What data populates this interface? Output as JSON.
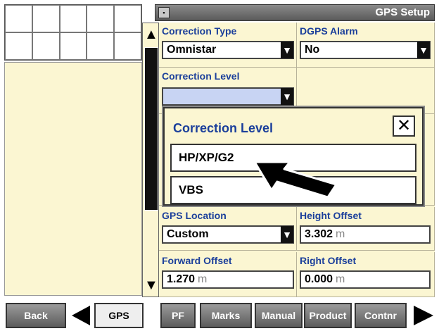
{
  "window": {
    "title": "GPS Setup",
    "icon": "window-icon"
  },
  "fields": {
    "correction_type": {
      "label": "Correction Type",
      "value": "Omnistar"
    },
    "dgps_alarm": {
      "label": "DGPS Alarm",
      "value": "No"
    },
    "correction_level": {
      "label": "Correction Level",
      "value": ""
    },
    "gps_location": {
      "label": "GPS Location",
      "value": "Custom"
    },
    "height_offset": {
      "label": "Height Offset",
      "value": "3.302",
      "unit": "m"
    },
    "forward_offset": {
      "label": "Forward Offset",
      "value": "1.270",
      "unit": "m"
    },
    "right_offset": {
      "label": "Right Offset",
      "value": "0.000",
      "unit": "m"
    }
  },
  "popup": {
    "title": "Correction Level",
    "close": "✕",
    "options": [
      "HP/XP/G2",
      "VBS"
    ]
  },
  "bottom_bar": {
    "back": "Back",
    "gps": "GPS",
    "pf": "PF",
    "marks": "Marks",
    "manual": "Manual",
    "product": "Product",
    "contnr": "Contnr"
  }
}
